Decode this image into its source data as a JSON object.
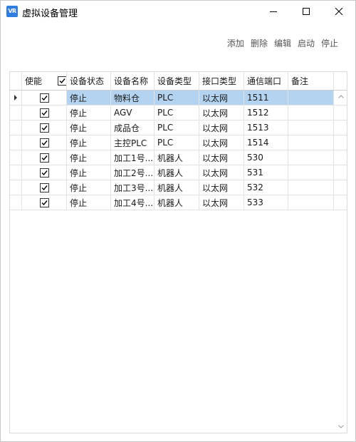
{
  "window": {
    "title": "虚拟设备管理",
    "icon_text": "VR"
  },
  "toolbar": {
    "add": "添加",
    "delete": "删除",
    "edit": "编辑",
    "start": "启动",
    "stop": "停止"
  },
  "table": {
    "columns": [
      "使能",
      "设备状态",
      "设备名称",
      "设备类型",
      "接口类型",
      "通信端口",
      "备注"
    ],
    "header_enable_checked": true,
    "rows": [
      {
        "enabled": true,
        "status": "停止",
        "name": "物料仓",
        "type": "PLC",
        "iface": "以太网",
        "port": "1511",
        "remark": ""
      },
      {
        "enabled": true,
        "status": "停止",
        "name": "AGV",
        "type": "PLC",
        "iface": "以太网",
        "port": "1512",
        "remark": ""
      },
      {
        "enabled": true,
        "status": "停止",
        "name": "成品仓",
        "type": "PLC",
        "iface": "以太网",
        "port": "1513",
        "remark": ""
      },
      {
        "enabled": true,
        "status": "停止",
        "name": "主控PLC",
        "type": "PLC",
        "iface": "以太网",
        "port": "1514",
        "remark": ""
      },
      {
        "enabled": true,
        "status": "停止",
        "name": "加工1号...",
        "type": "机器人",
        "iface": "以太网",
        "port": "530",
        "remark": ""
      },
      {
        "enabled": true,
        "status": "停止",
        "name": "加工2号...",
        "type": "机器人",
        "iface": "以太网",
        "port": "531",
        "remark": ""
      },
      {
        "enabled": true,
        "status": "停止",
        "name": "加工3号...",
        "type": "机器人",
        "iface": "以太网",
        "port": "532",
        "remark": ""
      },
      {
        "enabled": true,
        "status": "停止",
        "name": "加工4号...",
        "type": "机器人",
        "iface": "以太网",
        "port": "533",
        "remark": ""
      }
    ],
    "selected_row": 0
  },
  "colors": {
    "selection": "#b3d3f0",
    "app_icon": "#2f7de1"
  },
  "icons": {
    "app": "vr-app-icon",
    "minimize": "minimize-icon",
    "maximize": "maximize-icon",
    "close": "close-icon",
    "row_indicator": "row-pointer-icon",
    "scroll_up": "chevron-up-icon",
    "scroll_down": "chevron-down-icon"
  }
}
